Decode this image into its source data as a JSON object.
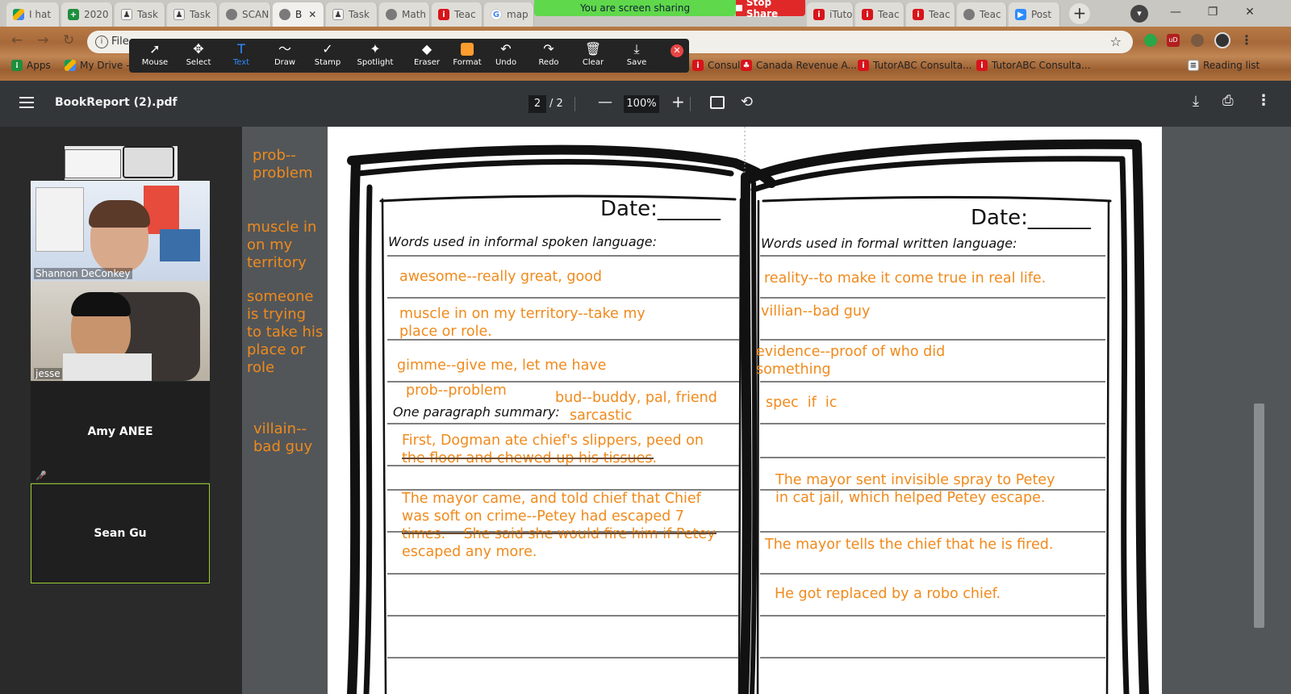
{
  "browser": {
    "tabs": [
      {
        "label": "I hat",
        "icon": "drive-icon"
      },
      {
        "label": "2020",
        "icon": "sheets-icon"
      },
      {
        "label": "Task",
        "icon": "doc-icon"
      },
      {
        "label": "Task",
        "icon": "doc-icon"
      },
      {
        "label": "SCAN",
        "icon": "globe-icon"
      },
      {
        "label": "B",
        "icon": "globe-icon",
        "active": true
      },
      {
        "label": "Task",
        "icon": "doc-icon"
      },
      {
        "label": "Math",
        "icon": "globe-icon"
      },
      {
        "label": "Teac",
        "icon": "tutorabc-icon"
      },
      {
        "label": "map",
        "icon": "google-icon"
      },
      {
        "label": "iTuto",
        "icon": "tutorabc-icon"
      },
      {
        "label": "Teac",
        "icon": "tutorabc-icon"
      },
      {
        "label": "Teac",
        "icon": "tutorabc-icon"
      },
      {
        "label": "Teac",
        "icon": "globe-icon"
      },
      {
        "label": "Post",
        "icon": "zoom-icon"
      }
    ],
    "new_tab": "+",
    "address": "File",
    "bookmarks": [
      {
        "label": "Apps",
        "icon": "apps-icon"
      },
      {
        "label": "My Drive -",
        "icon": "drive-icon"
      },
      {
        "label": "Consul...",
        "icon": "tutorabc-icon"
      },
      {
        "label": "Canada Revenue A...",
        "icon": "maple-icon"
      },
      {
        "label": "TutorABC Consulta...",
        "icon": "tutorabc-icon"
      },
      {
        "label": "TutorABC Consulta...",
        "icon": "tutorabc-icon"
      },
      {
        "label": "Reading list",
        "icon": "reading-list-icon"
      }
    ]
  },
  "screen_share": {
    "banner": "You are screen sharing",
    "stop_label": "Stop Share"
  },
  "annotate_toolbar": {
    "tools": [
      {
        "label": "Mouse",
        "icon": "cursor-icon"
      },
      {
        "label": "Select",
        "icon": "move-icon"
      },
      {
        "label": "Text",
        "icon": "text-icon",
        "selected": true
      },
      {
        "label": "Draw",
        "icon": "draw-icon"
      },
      {
        "label": "Stamp",
        "icon": "check-icon"
      },
      {
        "label": "Spotlight",
        "icon": "wand-icon"
      },
      {
        "label": "Eraser",
        "icon": "eraser-icon"
      },
      {
        "label": "Format",
        "icon": "format-icon"
      },
      {
        "label": "Undo",
        "icon": "undo-icon"
      },
      {
        "label": "Redo",
        "icon": "redo-icon"
      },
      {
        "label": "Clear",
        "icon": "trash-icon"
      },
      {
        "label": "Save",
        "icon": "save-icon"
      }
    ],
    "accent_color": "#ff9d2e"
  },
  "pdf_viewer": {
    "title": "BookReport (2).pdf",
    "current_page": "2",
    "page_total": "/ 2",
    "zoom": "100%"
  },
  "gallery": {
    "participants": [
      {
        "name": "Shannon DeConkey",
        "video": true
      },
      {
        "name": "jesse",
        "video": true
      },
      {
        "name": "Amy ANEE",
        "video": false,
        "muted": true
      },
      {
        "name": "Sean Gu",
        "video": false,
        "active_speaker": true
      }
    ]
  },
  "side_notes": [
    "prob--\nproblem",
    "muscle in\non my\nterritory",
    "someone\nis trying\nto take his\nplace or\nrole",
    "villain--\nbad guy"
  ],
  "worksheet": {
    "date_label": "Date:______",
    "left_heading": "Words used in informal spoken language:",
    "right_heading": "Words used in formal written language:",
    "summary_label": "One paragraph summary:",
    "left_entries": [
      "awesome--really great, good",
      "muscle in on my territory--take my\nplace or role.",
      "gimme--give me, let me have",
      "prob--problem",
      "bud--buddy, pal, friend",
      "sarcastic",
      "First, Dogman ate chief's slippers, peed on\nthe floor and chewed up his tissues.",
      "The mayor came, and told chief that Chief\nwas soft on crime--Petey had escaped 7\ntimes.    She said she would fire him if Petey\nescaped any more."
    ],
    "right_entries": [
      "reality--to make it come true in real life.",
      "villian--bad guy",
      "evidence--proof of who did\nsomething",
      "spec  if  ic",
      "The mayor sent invisible spray to Petey\nin cat jail, which helped Petey escape.",
      "The mayor tells the chief that he is fired.",
      "He got replaced by a robo chief."
    ],
    "ink_color": "#f08a1c"
  }
}
